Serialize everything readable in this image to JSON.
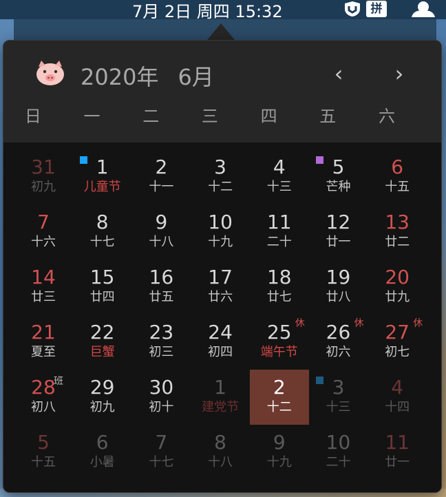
{
  "menubar": {
    "datetime": "7月 2日 周四 15:32",
    "icons": [
      "shield-icon",
      "pinyin-input-icon",
      "user-icon"
    ],
    "pinyin_label": "拼"
  },
  "calendar": {
    "year_label": "2020年",
    "month_label": "6月",
    "prev_icon": "chevron-left-icon",
    "next_icon": "chevron-right-icon",
    "prev_glyph": "‹",
    "next_glyph": "›",
    "weekdays": [
      "日",
      "一",
      "二",
      "三",
      "四",
      "五",
      "六"
    ],
    "days": [
      {
        "num": "31",
        "lunar": "初九",
        "style": "faded-red",
        "lstyle": "faded"
      },
      {
        "num": "1",
        "lunar": "儿童节",
        "style": "normal",
        "lstyle": "holiday",
        "mark": "#1aa3ff"
      },
      {
        "num": "2",
        "lunar": "十一",
        "style": "normal",
        "lstyle": "lunar"
      },
      {
        "num": "3",
        "lunar": "十二",
        "style": "normal",
        "lstyle": "lunar"
      },
      {
        "num": "4",
        "lunar": "十三",
        "style": "normal",
        "lstyle": "lunar"
      },
      {
        "num": "5",
        "lunar": "芒种",
        "style": "normal",
        "lstyle": "lunar",
        "mark": "#b36ad6"
      },
      {
        "num": "6",
        "lunar": "十五",
        "style": "weekend",
        "lstyle": "lunar"
      },
      {
        "num": "7",
        "lunar": "十六",
        "style": "weekend",
        "lstyle": "lunar"
      },
      {
        "num": "8",
        "lunar": "十七",
        "style": "normal",
        "lstyle": "lunar"
      },
      {
        "num": "9",
        "lunar": "十八",
        "style": "normal",
        "lstyle": "lunar"
      },
      {
        "num": "10",
        "lunar": "十九",
        "style": "normal",
        "lstyle": "lunar"
      },
      {
        "num": "11",
        "lunar": "二十",
        "style": "normal",
        "lstyle": "lunar"
      },
      {
        "num": "12",
        "lunar": "廿一",
        "style": "normal",
        "lstyle": "lunar"
      },
      {
        "num": "13",
        "lunar": "廿二",
        "style": "weekend",
        "lstyle": "lunar"
      },
      {
        "num": "14",
        "lunar": "廿三",
        "style": "weekend",
        "lstyle": "lunar"
      },
      {
        "num": "15",
        "lunar": "廿四",
        "style": "normal",
        "lstyle": "lunar"
      },
      {
        "num": "16",
        "lunar": "廿五",
        "style": "normal",
        "lstyle": "lunar"
      },
      {
        "num": "17",
        "lunar": "廿六",
        "style": "normal",
        "lstyle": "lunar"
      },
      {
        "num": "18",
        "lunar": "廿七",
        "style": "normal",
        "lstyle": "lunar"
      },
      {
        "num": "19",
        "lunar": "廿八",
        "style": "normal",
        "lstyle": "lunar"
      },
      {
        "num": "20",
        "lunar": "廿九",
        "style": "weekend",
        "lstyle": "lunar"
      },
      {
        "num": "21",
        "lunar": "夏至",
        "style": "weekend",
        "lstyle": "lunar"
      },
      {
        "num": "22",
        "lunar": "巨蟹",
        "style": "normal",
        "lstyle": "holiday"
      },
      {
        "num": "23",
        "lunar": "初三",
        "style": "normal",
        "lstyle": "lunar"
      },
      {
        "num": "24",
        "lunar": "初四",
        "style": "normal",
        "lstyle": "lunar"
      },
      {
        "num": "25",
        "lunar": "端午节",
        "style": "normal",
        "lstyle": "holiday",
        "tag": "休"
      },
      {
        "num": "26",
        "lunar": "初六",
        "style": "normal",
        "lstyle": "lunar",
        "tag": "休"
      },
      {
        "num": "27",
        "lunar": "初七",
        "style": "weekend",
        "lstyle": "lunar",
        "tag": "休"
      },
      {
        "num": "28",
        "lunar": "初八",
        "style": "weekend",
        "lstyle": "lunar",
        "ban": "班"
      },
      {
        "num": "29",
        "lunar": "初九",
        "style": "normal",
        "lstyle": "lunar"
      },
      {
        "num": "30",
        "lunar": "初十",
        "style": "normal",
        "lstyle": "lunar"
      },
      {
        "num": "1",
        "lunar": "建党节",
        "style": "faded",
        "lstyle": "faded-holiday"
      },
      {
        "num": "2",
        "lunar": "十二",
        "style": "normal",
        "lstyle": "lunar",
        "selected": true
      },
      {
        "num": "3",
        "lunar": "十三",
        "style": "faded",
        "lstyle": "faded",
        "mark": "#1e5a80"
      },
      {
        "num": "4",
        "lunar": "十四",
        "style": "faded-red",
        "lstyle": "faded"
      },
      {
        "num": "5",
        "lunar": "十五",
        "style": "faded-red",
        "lstyle": "faded"
      },
      {
        "num": "6",
        "lunar": "小暑",
        "style": "faded",
        "lstyle": "faded"
      },
      {
        "num": "7",
        "lunar": "十七",
        "style": "faded",
        "lstyle": "faded"
      },
      {
        "num": "8",
        "lunar": "十八",
        "style": "faded",
        "lstyle": "faded"
      },
      {
        "num": "9",
        "lunar": "十九",
        "style": "faded",
        "lstyle": "faded"
      },
      {
        "num": "10",
        "lunar": "二十",
        "style": "faded",
        "lstyle": "faded"
      },
      {
        "num": "11",
        "lunar": "廿一",
        "style": "faded-red",
        "lstyle": "faded"
      }
    ]
  }
}
